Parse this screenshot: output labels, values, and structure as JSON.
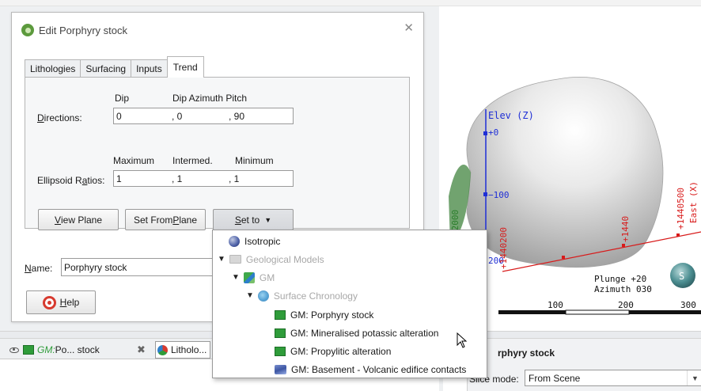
{
  "dialog": {
    "title": "Edit Porphyry stock",
    "close_glyph": "✕",
    "tabs": [
      "Lithologies",
      "Surfacing",
      "Inputs",
      "Trend"
    ],
    "active_tab": "Trend",
    "directions": {
      "label_pre": "D",
      "label_post": "irections:",
      "headers": {
        "dip": "Dip",
        "azimuth_pitch": "Dip Azimuth Pitch"
      },
      "values": {
        "dip": "0",
        "dip_azimuth": ", 0",
        "pitch": ", 90"
      }
    },
    "ellipsoid": {
      "label_pre": "Ellipsoid R",
      "label_u": "a",
      "label_post": "tios:",
      "headers": {
        "maximum": "Maximum",
        "intermed": "Intermed.",
        "minimum": "Minimum"
      },
      "values": {
        "maximum": "1",
        "intermed": ", 1",
        "minimum": ", 1"
      }
    },
    "buttons": {
      "view_plane": {
        "u": "V",
        "rest": "iew Plane"
      },
      "set_from_plane": {
        "pre": "Set From ",
        "u": "P",
        "rest": "lane"
      },
      "set_to": {
        "u": "S",
        "rest": "et to",
        "arrow": "▼"
      }
    },
    "name": {
      "label_u": "N",
      "label_rest": "ame:",
      "value": "Porphyry stock"
    },
    "help": {
      "u": "H",
      "rest": "elp"
    }
  },
  "menu": {
    "isotropic": "Isotropic",
    "geological_models": "Geological Models",
    "gm": "GM",
    "surface_chronology": "Surface Chronology",
    "items": [
      "GM: Porphyry stock",
      "GM: Mineralised potassic alteration",
      "GM: Propylitic alteration",
      "GM: Basement - Volcanic edifice contacts"
    ],
    "expand_glyph": "▼"
  },
  "scene": {
    "elev_label": "Elev (Z)",
    "elev_ticks": [
      "+0",
      "−100"
    ],
    "north_ticks": [
      "+1440200",
      "+1440",
      "+1440500"
    ],
    "east_label": "East (X)",
    "partial_left": [
      "02000",
      "200"
    ],
    "plunge": "Plunge +20",
    "azimuth": "Azimuth 030",
    "scale_ticks": [
      "100",
      "200",
      "300"
    ],
    "compass_letter": "S"
  },
  "bottom_tabs": [
    {
      "prefix": "GM:",
      "label": " Po... stock"
    },
    {
      "label": "Litholo..."
    }
  ],
  "properties": {
    "title": "rphyry stock",
    "slice_label": "Slice mode:",
    "slice_value": "From Scene"
  },
  "colors": {
    "accent_blue": "#1f2fd6",
    "axis_red": "#d81b1b",
    "lith_green": "#2f9c3a"
  }
}
